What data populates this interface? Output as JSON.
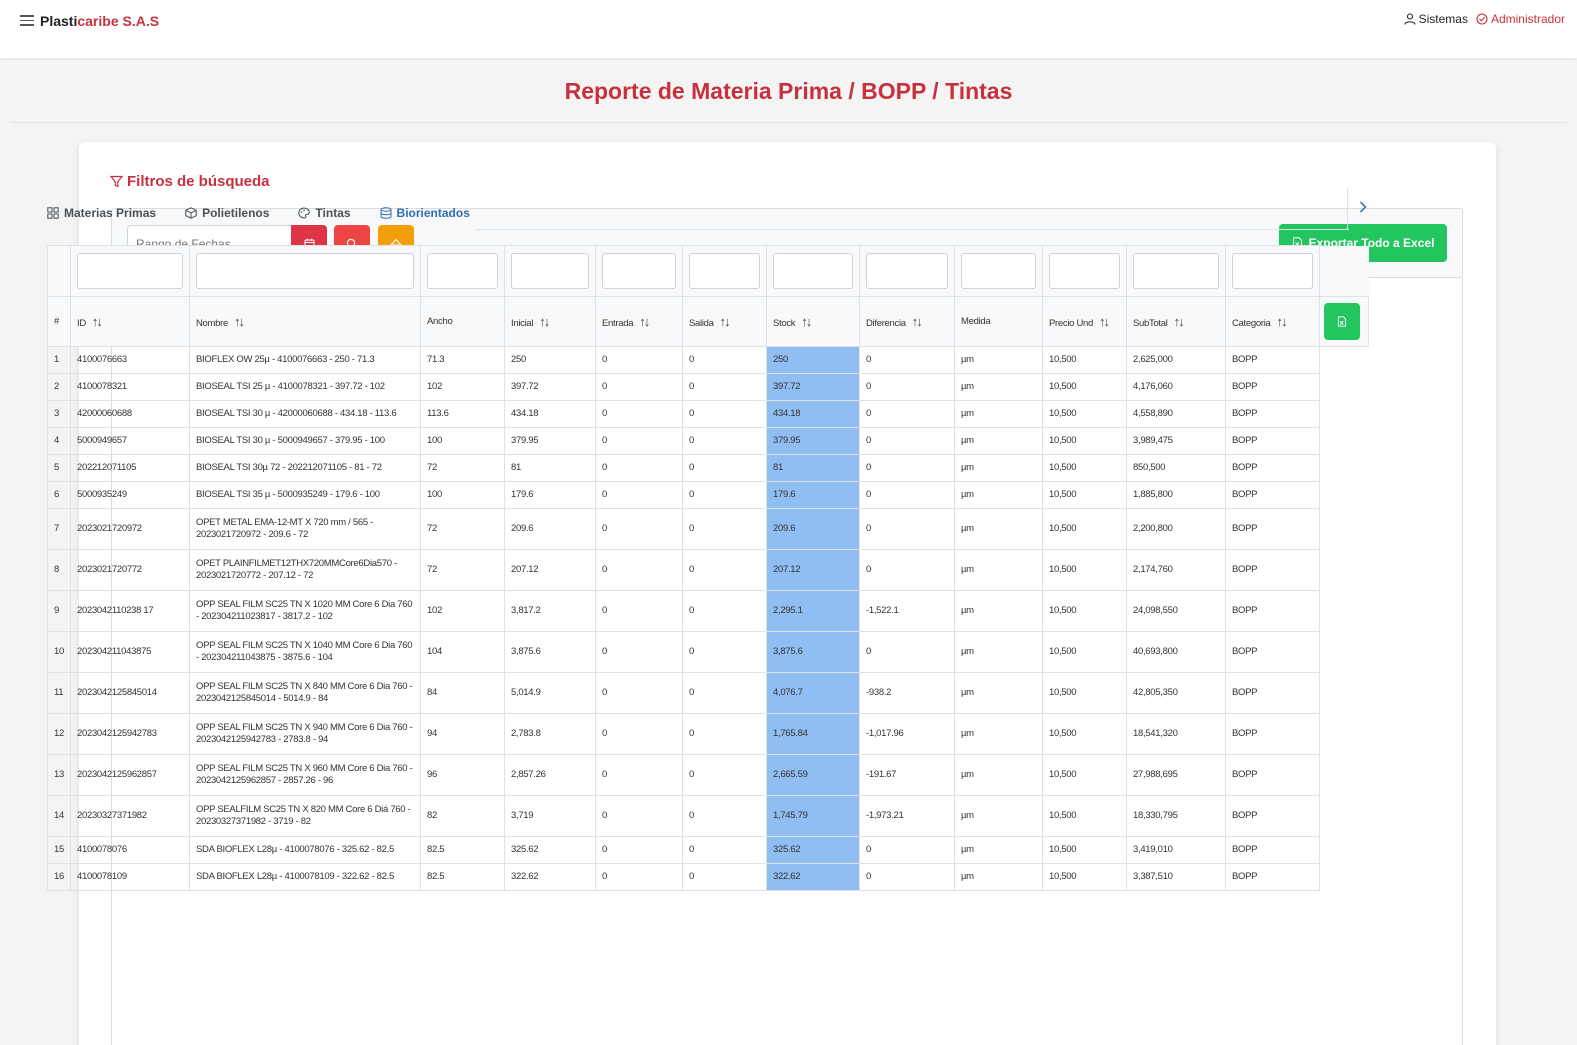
{
  "navbar": {
    "brand_part1": "Plasti",
    "brand_part2": "caribe S.A.S",
    "systems_label": "Sistemas",
    "admin_label": "Administrador"
  },
  "page": {
    "title": "Reporte de Materia Prima / BOPP / Tintas"
  },
  "filters": {
    "title": "Filtros de búsqueda",
    "date_placeholder": "Rango de Fechas",
    "export_label": "Exportar Todo a Excel"
  },
  "tabs": [
    {
      "label": "Materias Primas",
      "icon": "grid-icon"
    },
    {
      "label": "Polietilenos",
      "icon": "box-icon"
    },
    {
      "label": "Tintas",
      "icon": "palette-icon"
    },
    {
      "label": "Biorientados",
      "icon": "database-icon",
      "active": true
    }
  ],
  "table": {
    "columns": [
      "#",
      "ID",
      "Nombre",
      "Ancho",
      "Inicial",
      "Entrada",
      "Salida",
      "Stock",
      "Diferencia",
      "Medida",
      "Precio Und",
      "SubTotal",
      "Categoria"
    ],
    "rows": [
      [
        "1",
        "4100076663",
        "BIOFLEX OW 25µ - 4100076663 - 250 - 71.3",
        "71.3",
        "250",
        "0",
        "0",
        "250",
        "0",
        "µm",
        "10,500",
        "2,625,000",
        "BOPP"
      ],
      [
        "2",
        "4100078321",
        "BIOSEAL TSI 25 µ - 4100078321 - 397.72 - 102",
        "102",
        "397.72",
        "0",
        "0",
        "397.72",
        "0",
        "µm",
        "10,500",
        "4,176,060",
        "BOPP"
      ],
      [
        "3",
        "42000060688",
        "BIOSEAL TSI 30 µ - 42000060688 - 434.18 - 113.6",
        "113.6",
        "434.18",
        "0",
        "0",
        "434.18",
        "0",
        "µm",
        "10,500",
        "4,558,890",
        "BOPP"
      ],
      [
        "4",
        "5000949657",
        "BIOSEAL TSI 30 µ - 5000949657 - 379.95 - 100",
        "100",
        "379.95",
        "0",
        "0",
        "379.95",
        "0",
        "µm",
        "10,500",
        "3,989,475",
        "BOPP"
      ],
      [
        "5",
        "202212071105",
        "BIOSEAL TSI 30µ 72 - 202212071105 - 81 - 72",
        "72",
        "81",
        "0",
        "0",
        "81",
        "0",
        "µm",
        "10,500",
        "850,500",
        "BOPP"
      ],
      [
        "6",
        "5000935249",
        "BIOSEAL TSI 35 µ - 5000935249 - 179.6 - 100",
        "100",
        "179.6",
        "0",
        "0",
        "179.6",
        "0",
        "µm",
        "10,500",
        "1,885,800",
        "BOPP"
      ],
      [
        "7",
        "2023021720972",
        "OPET METAL EMA-12-MT X 720 mm / 565 - 2023021720972 - 209.6 - 72",
        "72",
        "209.6",
        "0",
        "0",
        "209.6",
        "0",
        "µm",
        "10,500",
        "2,200,800",
        "BOPP"
      ],
      [
        "8",
        "2023021720772",
        "OPET PLAINFILMET12THX720MMCore6Dia570 - 2023021720772 - 207.12 - 72",
        "72",
        "207.12",
        "0",
        "0",
        "207.12",
        "0",
        "µm",
        "10,500",
        "2,174,760",
        "BOPP"
      ],
      [
        "9",
        "2023042110238 17",
        "OPP SEAL FILM SC25 TN X 1020 MM Core 6 Dia 760 - 202304211023817 - 3817.2 - 102",
        "102",
        "3,817.2",
        "0",
        "0",
        "2,295.1",
        "-1,522.1",
        "µm",
        "10,500",
        "24,098,550",
        "BOPP"
      ],
      [
        "10",
        "202304211043875",
        "OPP SEAL FILM SC25 TN X 1040 MM Core 6 Dia 760 - 202304211043875 - 3875.6 - 104",
        "104",
        "3,875.6",
        "0",
        "0",
        "3,875.6",
        "0",
        "µm",
        "10,500",
        "40,693,800",
        "BOPP"
      ],
      [
        "11",
        "2023042125845014",
        "OPP SEAL FILM SC25 TN X 840 MM Core 6 Dia 760 - 2023042125845014 - 5014.9 - 84",
        "84",
        "5,014.9",
        "0",
        "0",
        "4,076.7",
        "-938.2",
        "µm",
        "10,500",
        "42,805,350",
        "BOPP"
      ],
      [
        "12",
        "2023042125942783",
        "OPP SEAL FILM SC25 TN X 940 MM Core 6 Dia 760 - 2023042125942783 - 2783.8 - 94",
        "94",
        "2,783.8",
        "0",
        "0",
        "1,765.84",
        "-1,017.96",
        "µm",
        "10,500",
        "18,541,320",
        "BOPP"
      ],
      [
        "13",
        "2023042125962857",
        "OPP SEAL FILM SC25 TN X 960 MM Core 6 Dia 760 - 2023042125962857 - 2857.26 - 96",
        "96",
        "2,857.26",
        "0",
        "0",
        "2,665.59",
        "-191.67",
        "µm",
        "10,500",
        "27,988,695",
        "BOPP"
      ],
      [
        "14",
        "20230327371982",
        "OPP SEALFILM SC25 TN X 820 MM Core 6 Diá 760 - 20230327371982 - 3719 - 82",
        "82",
        "3,719",
        "0",
        "0",
        "1,745.79",
        "-1,973.21",
        "µm",
        "10,500",
        "18,330,795",
        "BOPP"
      ],
      [
        "15",
        "4100078076",
        "SDA BIOFLEX L28µ - 4100078076 - 325.62 - 82.5",
        "82.5",
        "325.62",
        "0",
        "0",
        "325.62",
        "0",
        "µm",
        "10,500",
        "3,419,010",
        "BOPP"
      ],
      [
        "16",
        "4100078109",
        "SDA BIOFLEX L28µ - 4100078109 - 322.62 - 82.5",
        "82.5",
        "322.62",
        "0",
        "0",
        "322.62",
        "0",
        "µm",
        "10,500",
        "3,387,510",
        "BOPP"
      ]
    ]
  },
  "colors": {
    "brand_red": "#c7313d",
    "stock_highlight": "#90bef2",
    "excel_green": "#22c55e",
    "search_red": "#ef4444",
    "clear_orange": "#f59e0b",
    "active_tab": "#2f6fb1"
  }
}
